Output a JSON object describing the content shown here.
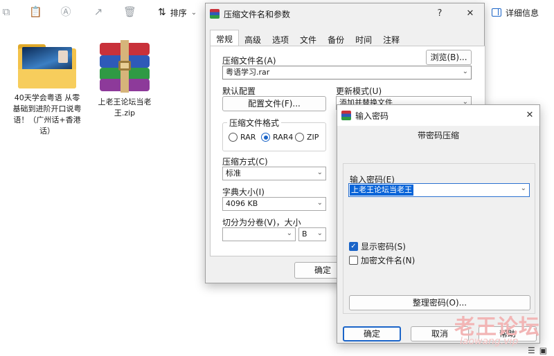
{
  "explorer": {
    "toolbar": {
      "sort_label": "排序",
      "sort_chevron": "⌄",
      "details_label": "详细信息"
    },
    "files": [
      {
        "label": "40天学会粤语 从零基础到进阶开口说粤语！（广州话+香港话）"
      },
      {
        "label": "上老王论坛当老王.zip"
      }
    ]
  },
  "archive_dialog": {
    "title": "压缩文件名和参数",
    "help_btn": "?",
    "close_btn": "✕",
    "tabs": [
      "常规",
      "高级",
      "选项",
      "文件",
      "备份",
      "时间",
      "注释"
    ],
    "archive_name_label": "压缩文件名(A)",
    "browse_button": "浏览(B)...",
    "archive_name_value": "粤语学习.rar",
    "default_profile_label": "默认配置",
    "profiles_button": "配置文件(F)...",
    "update_mode_label": "更新模式(U)",
    "update_mode_value": "添加并替换文件",
    "format_group_label": "压缩文件格式",
    "formats": [
      "RAR",
      "RAR4",
      "ZIP"
    ],
    "selected_format": "RAR4",
    "method_label": "压缩方式(C)",
    "method_value": "标准",
    "dict_label": "字典大小(I)",
    "dict_value": "4096 KB",
    "split_label": "切分为分卷(V)，大小",
    "split_unit": "B",
    "ok_button": "确定"
  },
  "password_dialog": {
    "title": "输入密码",
    "close_btn": "✕",
    "heading": "带密码压缩",
    "password_label": "输入密码(E)",
    "password_value": "上老王论坛当老王",
    "show_password_label": "显示密码(S)",
    "show_password_checked": true,
    "encrypt_names_label": "加密文件名(N)",
    "encrypt_names_checked": false,
    "organize_button": "整理密码(O)...",
    "ok_button": "确定",
    "cancel_button": "取消",
    "help_button": "帮助"
  },
  "watermark": {
    "text": "老王论坛",
    "url": "laowang.vip"
  },
  "colors": {
    "accent": "#1a64c8",
    "selection": "#0a64d8",
    "dialog_bg": "#f0f0f0"
  }
}
